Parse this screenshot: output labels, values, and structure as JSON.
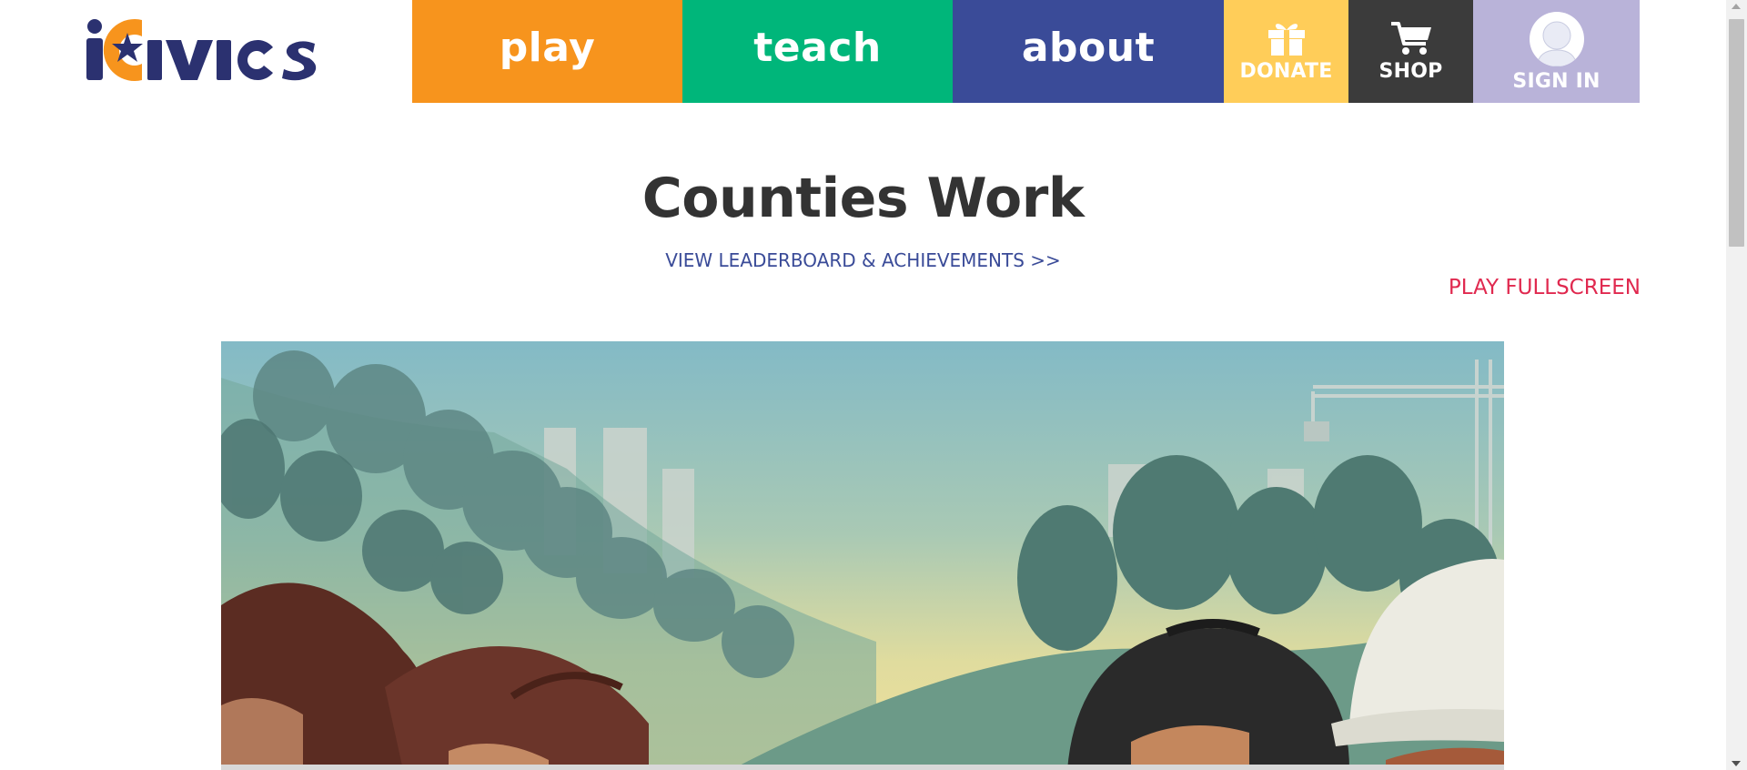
{
  "header": {
    "logo_text": "iCivics",
    "nav": {
      "play": "play",
      "teach": "teach",
      "about": "about",
      "donate": "DONATE",
      "shop": "SHOP",
      "sign_in": "SIGN IN"
    }
  },
  "main": {
    "title": "Counties Work",
    "leaderboard_link": "VIEW LEADERBOARD & ACHIEVEMENTS >>",
    "fullscreen_link": "PLAY FULLSCREEN"
  },
  "colors": {
    "play": "#f7941d",
    "teach": "#00b67a",
    "about": "#3a4b98",
    "donate": "#ffcd59",
    "shop": "#3b3b3b",
    "sign_in": "#b9b3d9",
    "fullscreen_link": "#e0294f",
    "link": "#3a4b98"
  },
  "icons": {
    "donate": "gift-icon",
    "shop": "cart-icon",
    "sign_in": "user-avatar-icon"
  }
}
